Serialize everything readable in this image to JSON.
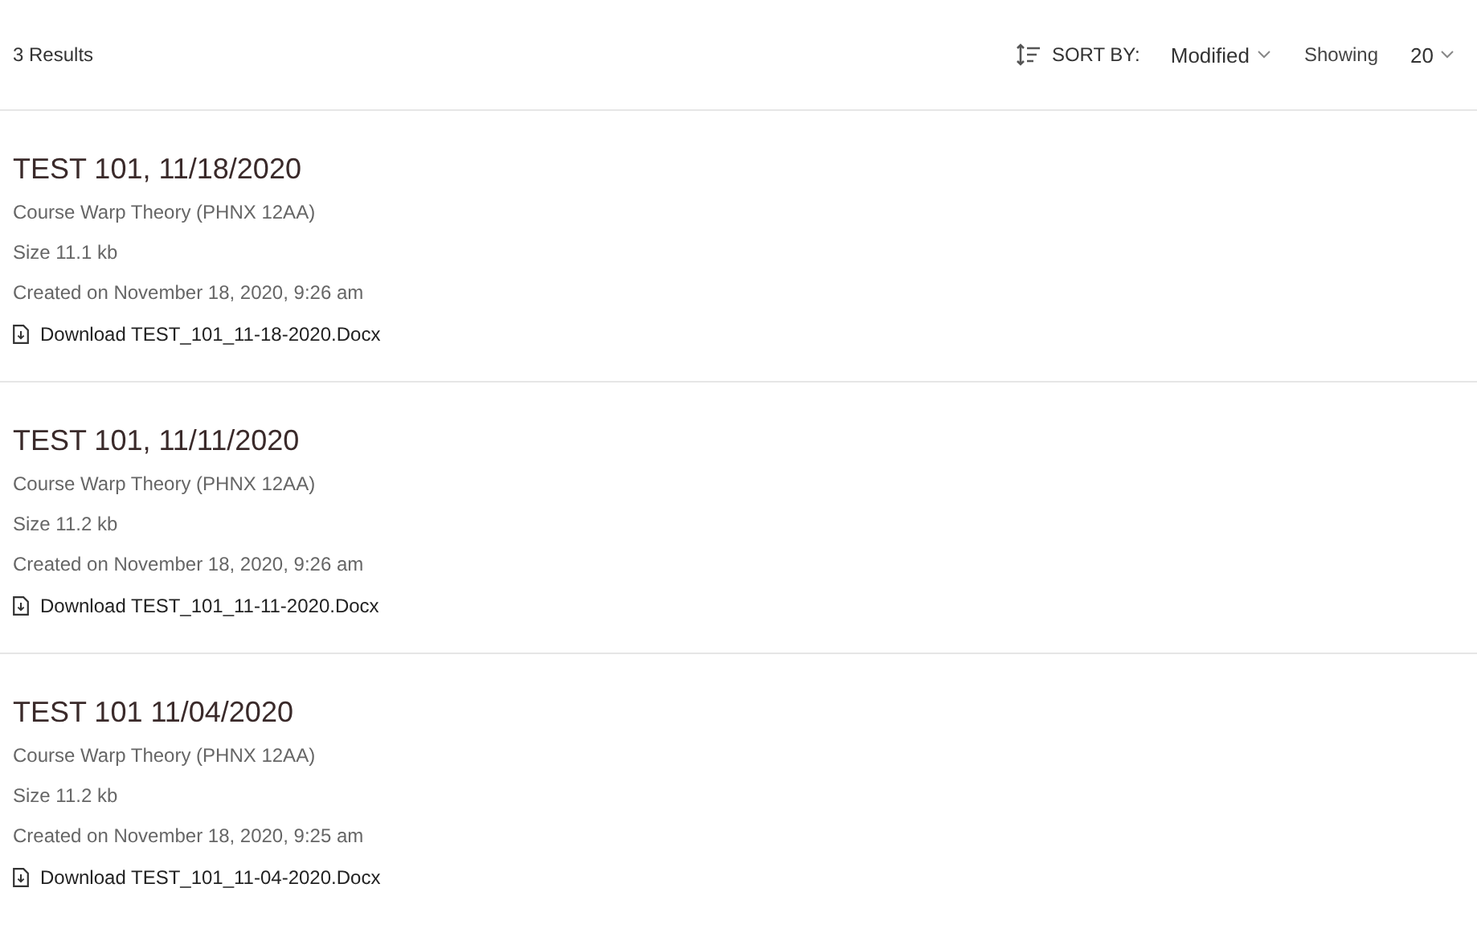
{
  "results_count": "3 Results",
  "sort": {
    "label": "SORT BY:",
    "value": "Modified"
  },
  "showing": {
    "label": "Showing",
    "value": "20"
  },
  "results": [
    {
      "title": "TEST 101, 11/18/2020",
      "course": "Course Warp Theory (PHNX 12AA)",
      "size": "Size 11.1 kb",
      "created": "Created on November 18, 2020, 9:26 am",
      "download": "Download TEST_101_11-18-2020.Docx"
    },
    {
      "title": "TEST 101, 11/11/2020",
      "course": "Course Warp Theory (PHNX 12AA)",
      "size": "Size 11.2 kb",
      "created": "Created on November 18, 2020, 9:26 am",
      "download": "Download TEST_101_11-11-2020.Docx"
    },
    {
      "title": "TEST 101 11/04/2020",
      "course": "Course Warp Theory (PHNX 12AA)",
      "size": "Size 11.2 kb",
      "created": "Created on November 18, 2020, 9:25 am",
      "download": "Download TEST_101_11-04-2020.Docx"
    }
  ]
}
